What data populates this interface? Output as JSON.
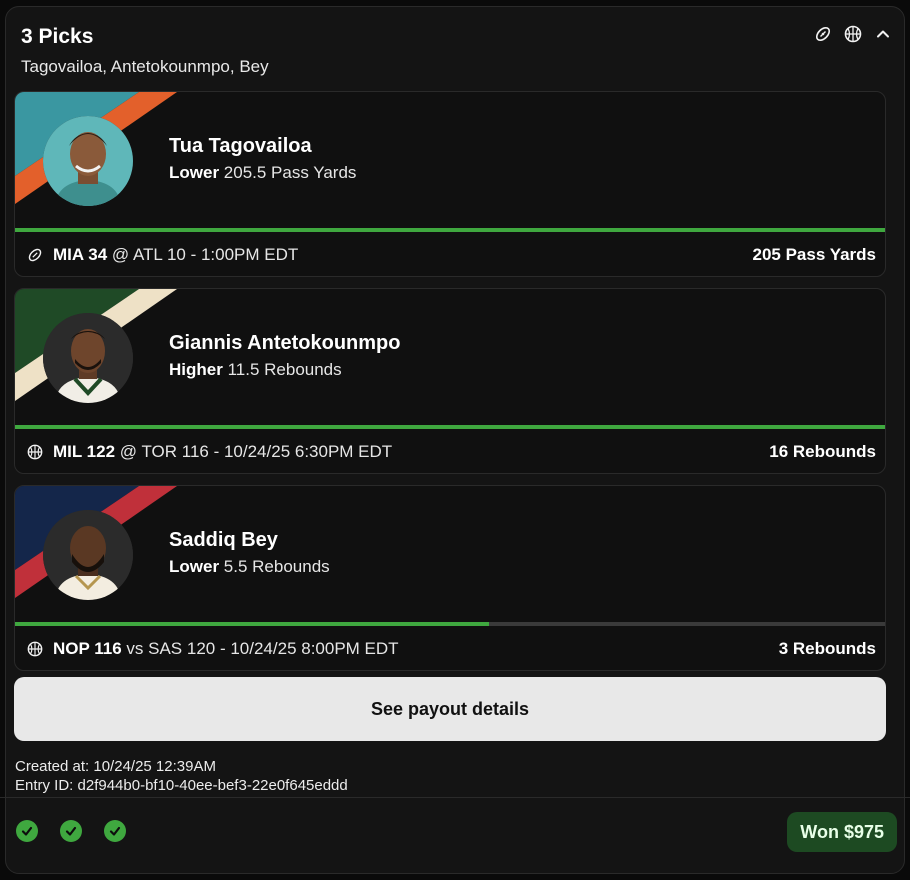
{
  "header": {
    "title": "3 Picks",
    "subtitle": "Tagovailoa, Antetokounmpo, Bey",
    "icons": [
      "football-icon",
      "basketball-icon",
      "chevron-up-icon"
    ]
  },
  "picks": [
    {
      "player": "Tua Tagovailoa",
      "direction": "Lower",
      "line": "205.5 Pass Yards",
      "sport_icon": "football-icon",
      "team": "MIA 34",
      "matchup": " @ ATL 10 - 1:00PM EDT",
      "result": "205 Pass Yards",
      "progress": 1.0,
      "colors": {
        "primary": "#3a97a1",
        "secondary": "#e3602b"
      }
    },
    {
      "player": "Giannis Antetokounmpo",
      "direction": "Higher",
      "line": "11.5 Rebounds",
      "sport_icon": "basketball-icon",
      "team": "MIL 122",
      "matchup": " @ TOR 116 - 10/24/25 6:30PM EDT",
      "result": "16 Rebounds",
      "progress": 1.0,
      "colors": {
        "primary": "#1f4a26",
        "secondary": "#eee1c6"
      }
    },
    {
      "player": "Saddiq Bey",
      "direction": "Lower",
      "line": "5.5 Rebounds",
      "sport_icon": "basketball-icon",
      "team": "NOP 116",
      "matchup": " vs SAS 120 - 10/24/25 8:00PM EDT",
      "result": "3 Rebounds",
      "progress": 0.545,
      "colors": {
        "primary": "#14264a",
        "secondary": "#c0303a"
      }
    }
  ],
  "payout_button": "See payout details",
  "meta": {
    "created": "Created at: 10/24/25 12:39AM",
    "entry_id": "Entry ID: d2f944b0-bf10-40ee-bef3-22e0f645eddd"
  },
  "footer": {
    "checks": [
      "check-icon",
      "check-icon",
      "check-icon"
    ],
    "won_label": "Won $975",
    "accent": "#3fa83f"
  }
}
